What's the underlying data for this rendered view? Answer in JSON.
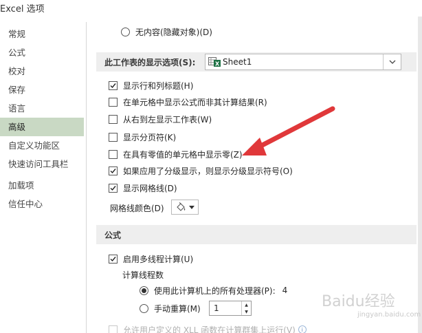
{
  "window": {
    "title": "Excel 选项"
  },
  "sidebar": {
    "items": [
      {
        "label": "常规",
        "active": false
      },
      {
        "label": "公式",
        "active": false
      },
      {
        "label": "校对",
        "active": false
      },
      {
        "label": "保存",
        "active": false
      },
      {
        "label": "语言",
        "active": false
      },
      {
        "label": "高级",
        "active": true
      },
      {
        "label": "自定义功能区",
        "active": false
      },
      {
        "label": "快速访问工具栏",
        "active": false
      },
      {
        "label": "加载项",
        "active": false
      },
      {
        "label": "信任中心",
        "active": false
      }
    ]
  },
  "objects": {
    "none_label": "无内容(隐藏对象)(D)",
    "selected": false
  },
  "worksheet_section": {
    "title": "此工作表的显示选项(S):",
    "sheet_value": "Sheet1",
    "options": [
      {
        "label": "显示行和列标题(H)",
        "checked": true
      },
      {
        "label": "在单元格中显示公式而非其计算结果(R)",
        "checked": false
      },
      {
        "label": "从右到左显示工作表(W)",
        "checked": false
      },
      {
        "label": "显示分页符(K)",
        "checked": false
      },
      {
        "label": "在具有零值的单元格中显示零(Z)",
        "checked": false
      },
      {
        "label": "如果应用了分级显示，则显示分级显示符号(O)",
        "checked": true
      },
      {
        "label": "显示网格线(D)",
        "checked": true
      }
    ],
    "gridline_color_label": "网格线颜色(D)"
  },
  "formula_section": {
    "title": "公式",
    "multithread_label": "启用多线程计算(U)",
    "multithread_checked": true,
    "threads_label": "计算线程数",
    "all_processors_label": "使用此计算机上的所有处理器(P):",
    "processor_count": "4",
    "manual_label": "手动重算(M)",
    "manual_value": "1",
    "xll_label": "允许用户定义的 XLL 函数在计算群集上运行(V)"
  },
  "colors": {
    "accent_arrow": "#e0383a",
    "active_nav": "#c9d9c4"
  },
  "watermark": {
    "text": "Baidu经验",
    "sub": "jingyan.baidu.com"
  }
}
